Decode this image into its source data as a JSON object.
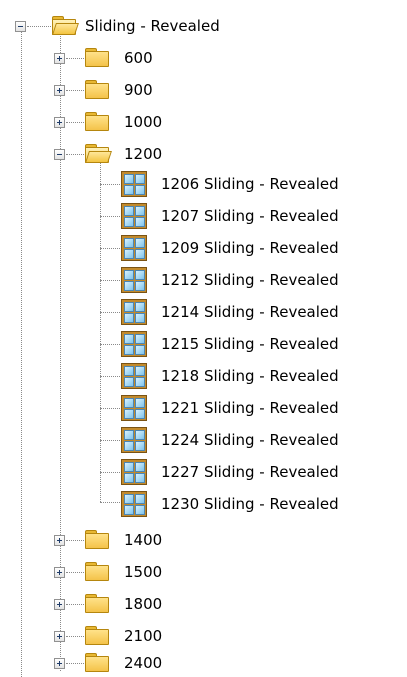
{
  "root": {
    "label": "Sliding - Revealed",
    "expanded": true
  },
  "folders_before": [
    {
      "label": "600",
      "expanded": false
    },
    {
      "label": "900",
      "expanded": false
    },
    {
      "label": "1000",
      "expanded": false
    }
  ],
  "open_folder": {
    "label": "1200",
    "expanded": true
  },
  "items": [
    {
      "label": "1206 Sliding - Revealed"
    },
    {
      "label": "1207 Sliding - Revealed"
    },
    {
      "label": "1209 Sliding - Revealed"
    },
    {
      "label": "1212 Sliding - Revealed"
    },
    {
      "label": "1214 Sliding - Revealed"
    },
    {
      "label": "1215 Sliding - Revealed"
    },
    {
      "label": "1218 Sliding - Revealed"
    },
    {
      "label": "1221 Sliding - Revealed"
    },
    {
      "label": "1224 Sliding - Revealed"
    },
    {
      "label": "1227 Sliding - Revealed"
    },
    {
      "label": "1230 Sliding - Revealed"
    }
  ],
  "folders_after": [
    {
      "label": "1400",
      "expanded": false
    },
    {
      "label": "1500",
      "expanded": false
    },
    {
      "label": "1800",
      "expanded": false
    },
    {
      "label": "2100",
      "expanded": false
    },
    {
      "label": "2400",
      "expanded": false
    }
  ],
  "icons": {
    "expander_collapsed": "plus-box-icon",
    "expander_expanded": "minus-box-icon",
    "folder_closed": "folder-icon",
    "folder_open": "open-folder-icon",
    "window_item": "window-icon"
  }
}
